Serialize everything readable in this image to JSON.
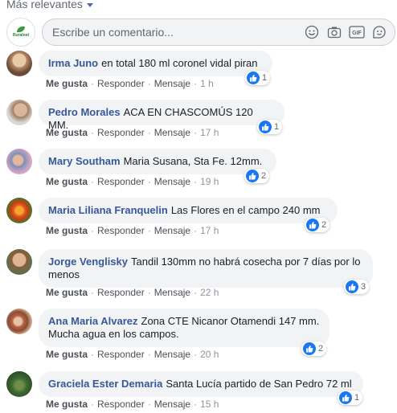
{
  "sort_label": "Más relevantes",
  "composer": {
    "logo_text": "Ruralnet",
    "placeholder": "Escribe un comentario...",
    "icons": [
      "emoji-icon",
      "camera-icon",
      "gif-icon",
      "sticker-icon"
    ]
  },
  "actions": {
    "like": "Me gusta",
    "reply": "Responder",
    "message": "Mensaje"
  },
  "comments": [
    {
      "author": "Irma Juno",
      "text": "en total 180 ml coronel vidal piran",
      "time": "1 h",
      "likes": "1"
    },
    {
      "author": "Pedro Morales",
      "text": "ACA EN CHASCOMÚS 120 MM.",
      "time": "17 h",
      "likes": "1"
    },
    {
      "author": "Mary Southam",
      "text": "Maria Susana, Sta Fe. 12mm.",
      "time": "19 h",
      "likes": "2"
    },
    {
      "author": "Maria Liliana Franquelin",
      "text": "Las Flores en el campo 240 mm",
      "time": "17 h",
      "likes": "2"
    },
    {
      "author": "Jorge Venglisky",
      "text": "Tandil 130mm no habrá cosecha por 7 días por lo menos",
      "time": "22 h",
      "likes": "3"
    },
    {
      "author": "Ana Maria Alvarez",
      "text": "Zona CTE Nicanor Otamendi 147 mm. Mucha agua en los campos.",
      "time": "20 h",
      "likes": "2"
    },
    {
      "author": "Graciela Ester Demaria",
      "text": "Santa Lucía partido de San Pedro 72 ml",
      "time": "15 h",
      "likes": "1"
    }
  ],
  "colors": {
    "link": "#385898",
    "like_blue": "#1877f2",
    "bubble": "#f2f3f5"
  }
}
